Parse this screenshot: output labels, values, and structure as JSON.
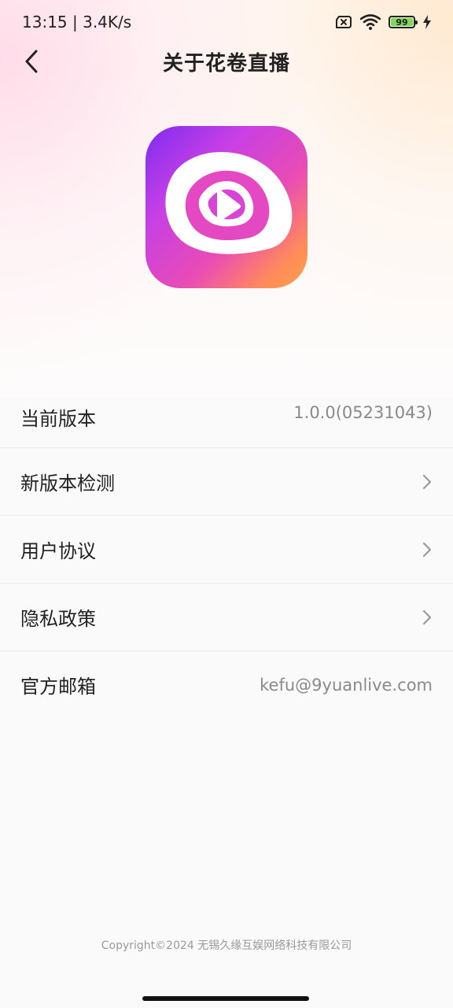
{
  "status_bar": {
    "time": "13:15 | 3.4K/s",
    "battery_level": "99",
    "battery_fraction": 0.99,
    "battery_color": "#7ed957"
  },
  "header": {
    "title": "关于花卷直播",
    "back_icon": "chevron-left-icon"
  },
  "logo": {
    "icon": "play-button-logo-icon",
    "gradient": [
      "#7d2cf0",
      "#ea4cb4",
      "#ffa24a"
    ]
  },
  "settings": {
    "current_version_label": "当前版本",
    "current_version_value": "1.0.0(05231043)",
    "check_update_label": "新版本检测",
    "user_agreement_label": "用户协议",
    "privacy_policy_label": "隐私政策",
    "official_email_label": "官方邮箱",
    "official_email_value": "kefu@9yuanlive.com"
  },
  "footer": {
    "copyright": "Copyright©2024 无锡久缘互娱网络科技有限公司"
  }
}
